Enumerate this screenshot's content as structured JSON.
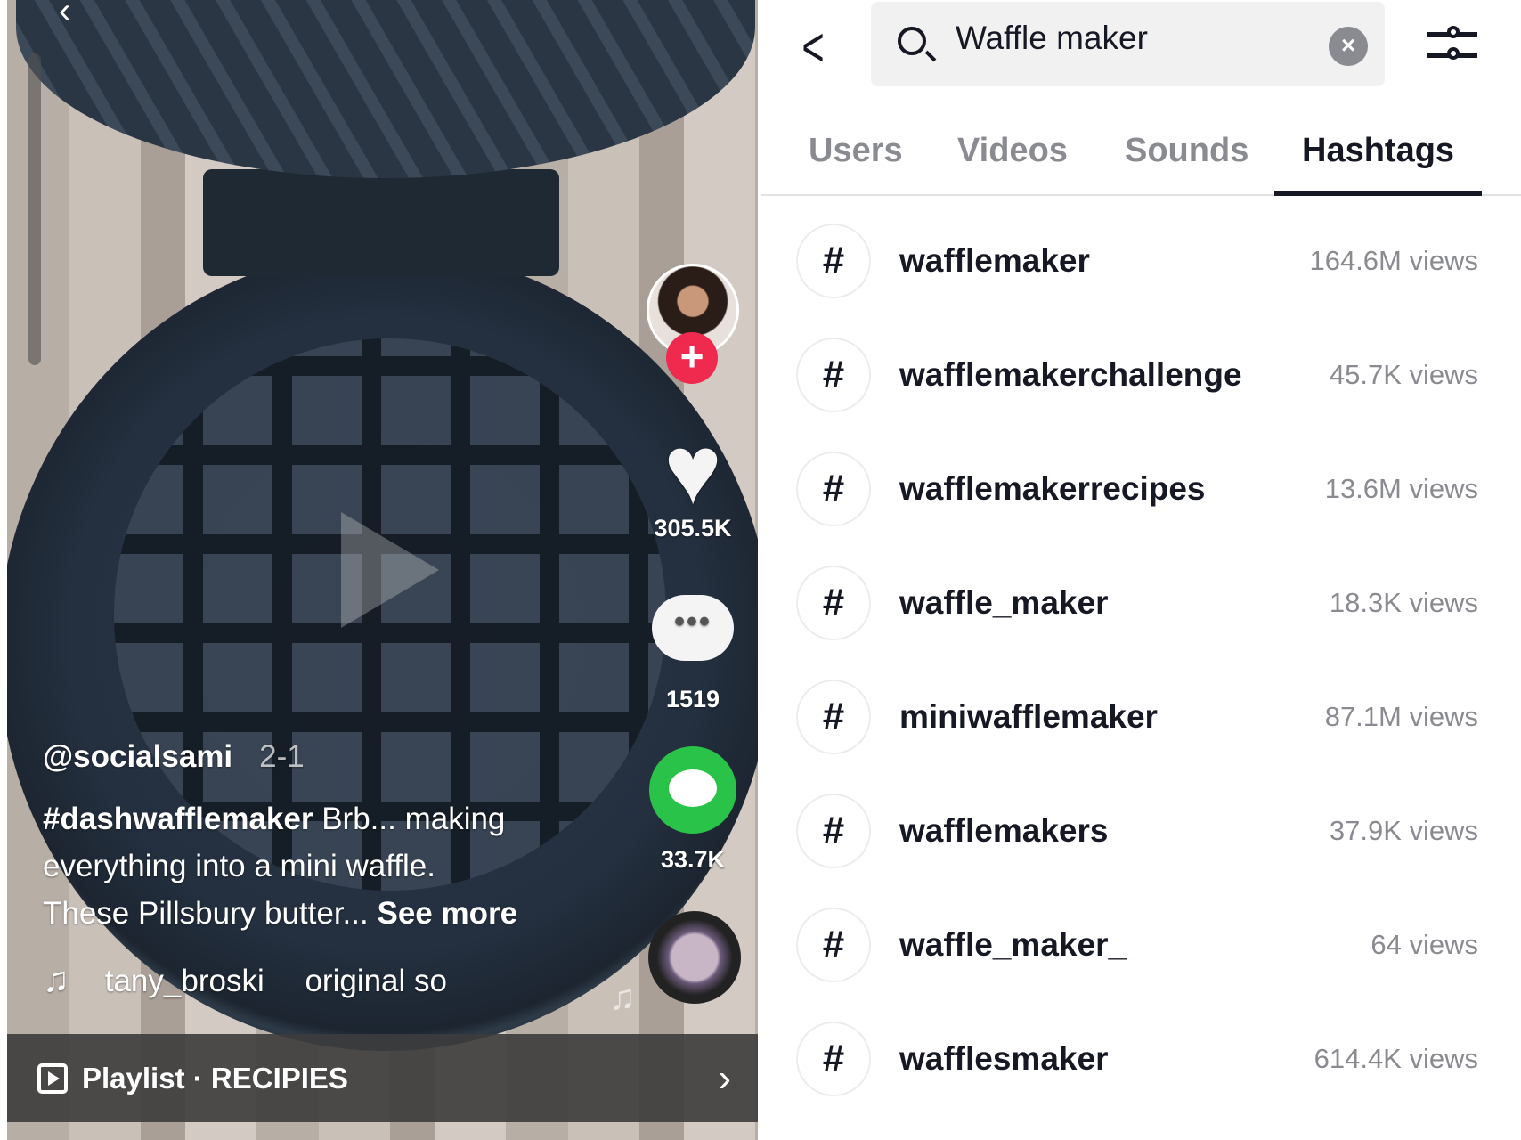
{
  "video": {
    "username": "@socialsami",
    "date": "2-1",
    "caption_hashtag": "#dashwafflemaker",
    "caption_line1": " Brb... making",
    "caption_line2": "everything into a mini waffle.",
    "caption_line3": "These Pillsbury butter...",
    "see_more": "See more",
    "music_author": "tany_broski",
    "music_title": "original so",
    "likes": "305.5K",
    "comments": "1519",
    "shares": "33.7K",
    "playlist": "Playlist · RECIPIES",
    "accent_follow": "#f0294f",
    "accent_share": "#2ac34a"
  },
  "search": {
    "value": "Waffle maker"
  },
  "tabs": [
    {
      "label": "Users"
    },
    {
      "label": "Videos"
    },
    {
      "label": "Sounds"
    },
    {
      "label": "Hashtags",
      "active": true
    }
  ],
  "hashtags": [
    {
      "name": "wafflemaker",
      "views": "164.6M views"
    },
    {
      "name": "wafflemakerchallenge",
      "views": "45.7K views"
    },
    {
      "name": "wafflemakerrecipes",
      "views": "13.6M views"
    },
    {
      "name": "waffle_maker",
      "views": "18.3K views"
    },
    {
      "name": "miniwafflemaker",
      "views": "87.1M views"
    },
    {
      "name": "wafflemakers",
      "views": "37.9K views"
    },
    {
      "name": "waffle_maker_",
      "views": "64 views"
    },
    {
      "name": "wafflesmaker",
      "views": "614.4K views"
    }
  ]
}
